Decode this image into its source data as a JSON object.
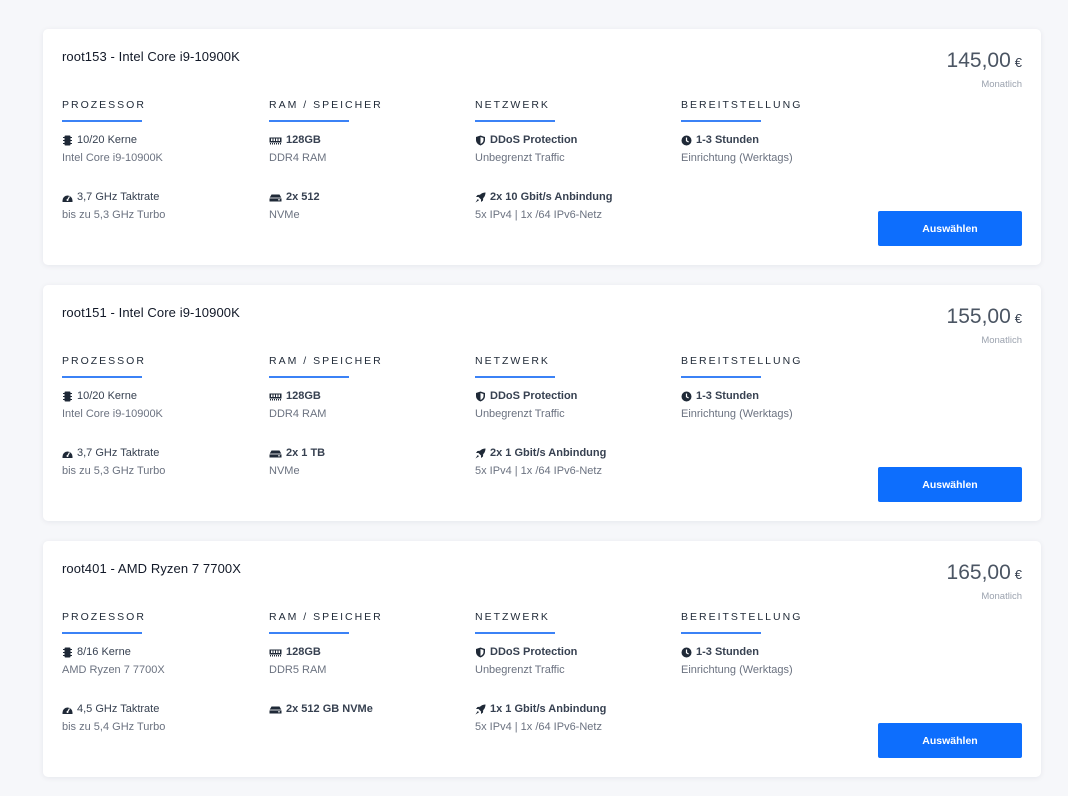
{
  "currency_symbol": "€",
  "accent_color": "#0d6efd",
  "column_headers": {
    "processor": "PROZESSOR",
    "ram": "RAM / SPEICHER",
    "network": "NETZWERK",
    "provisioning": "BEREITSTELLUNG"
  },
  "servers": [
    {
      "title": "root153 - Intel Core i9-10900K",
      "price": "145,00",
      "period": "Monatlich",
      "button_label": "Auswählen",
      "processor": {
        "cores": "10/20 Kerne",
        "cpu_model": "Intel Core i9-10900K",
        "clock": "3,7 GHz Taktrate",
        "turbo": "bis zu 5,3 GHz Turbo"
      },
      "ram": {
        "memory": "128GB",
        "memory_type": "DDR4 RAM",
        "storage": "2x 512",
        "storage_type": "NVMe"
      },
      "network": {
        "protection": "DDoS Protection",
        "traffic": "Unbegrenzt Traffic",
        "uplink": "2x 10 Gbit/s Anbindung",
        "ips": "5x IPv4 | 1x /64 IPv6-Netz"
      },
      "provisioning": {
        "time": "1-3 Stunden",
        "setup": "Einrichtung (Werktags)"
      }
    },
    {
      "title": "root151 - Intel Core i9-10900K",
      "price": "155,00",
      "period": "Monatlich",
      "button_label": "Auswählen",
      "processor": {
        "cores": "10/20 Kerne",
        "cpu_model": "Intel Core i9-10900K",
        "clock": "3,7 GHz Taktrate",
        "turbo": "bis zu 5,3 GHz Turbo"
      },
      "ram": {
        "memory": "128GB",
        "memory_type": "DDR4 RAM",
        "storage": "2x 1 TB",
        "storage_type": "NVMe"
      },
      "network": {
        "protection": "DDoS Protection",
        "traffic": "Unbegrenzt Traffic",
        "uplink": "2x 1 Gbit/s Anbindung",
        "ips": "5x IPv4 | 1x /64 IPv6-Netz"
      },
      "provisioning": {
        "time": "1-3 Stunden",
        "setup": "Einrichtung (Werktags)"
      }
    },
    {
      "title": "root401 - AMD Ryzen 7 7700X",
      "price": "165,00",
      "period": "Monatlich",
      "button_label": "Auswählen",
      "processor": {
        "cores": "8/16 Kerne",
        "cpu_model": "AMD Ryzen 7 7700X",
        "clock": "4,5 GHz Taktrate",
        "turbo": "bis zu 5,4 GHz Turbo"
      },
      "ram": {
        "memory": "128GB",
        "memory_type": "DDR5 RAM",
        "storage": "2x 512 GB NVMe",
        "storage_type": ""
      },
      "network": {
        "protection": "DDoS Protection",
        "traffic": "Unbegrenzt Traffic",
        "uplink": "1x 1 Gbit/s Anbindung",
        "ips": "5x IPv4 | 1x /64 IPv6-Netz"
      },
      "provisioning": {
        "time": "1-3 Stunden",
        "setup": "Einrichtung (Werktags)"
      }
    }
  ]
}
